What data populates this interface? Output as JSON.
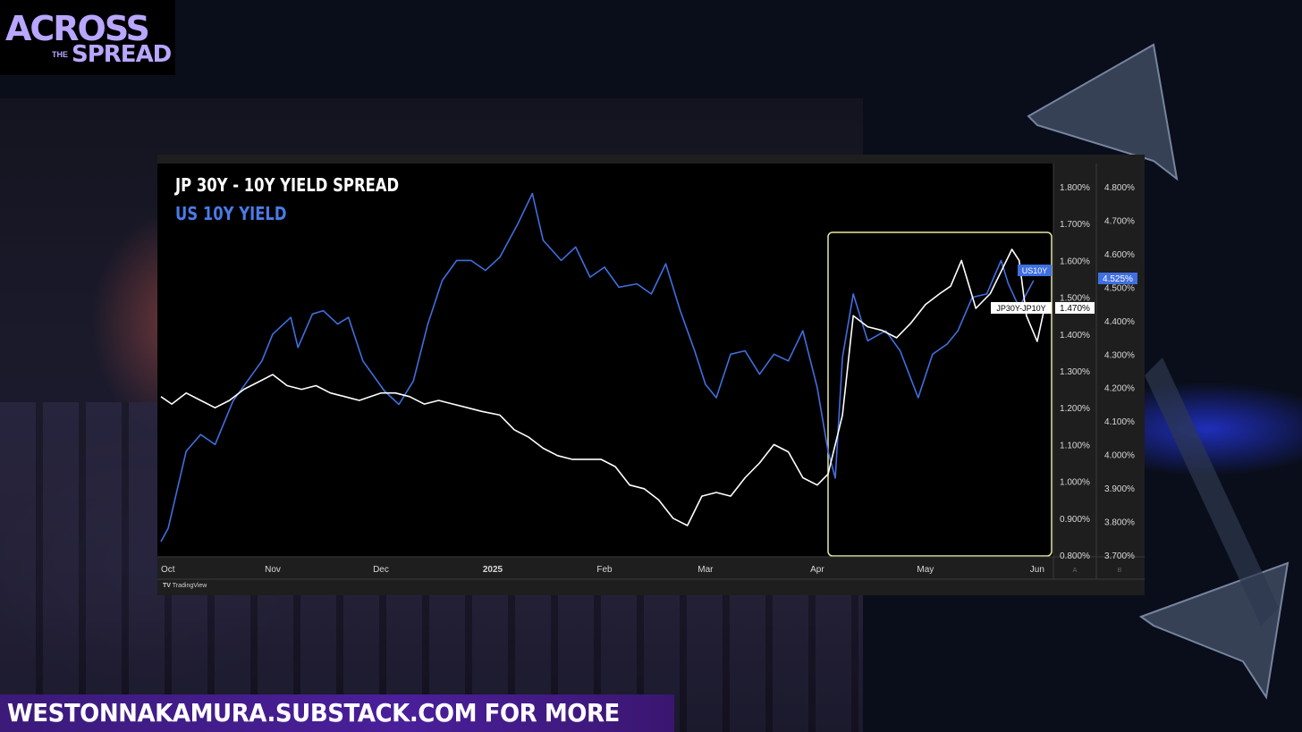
{
  "logo": {
    "line1": "ACROSS",
    "line2": "THE",
    "line3": "SPREAD"
  },
  "footer": {
    "text": "WESTONNAKAMURA.SUBSTACK.COM FOR MORE"
  },
  "tradingview": {
    "label": "TradingView"
  },
  "colors": {
    "us10y": "#3f6fe0",
    "jp_spread": "#ffffff",
    "highlight_box": "#e8e8a0",
    "background": "#000000"
  },
  "chart_data": {
    "type": "line",
    "title": "JP 30Y - 10Y YIELD SPREAD",
    "subtitle": "US 10Y YIELD",
    "x_ticks": [
      "Oct",
      "Nov",
      "Dec",
      "2025",
      "Feb",
      "Mar",
      "Apr",
      "May",
      "Jun"
    ],
    "x_range": [
      "2024-10-01",
      "2025-06-05"
    ],
    "axis_a": {
      "ticks": [
        "1.800%",
        "1.700%",
        "1.600%",
        "1.500%",
        "1.400%",
        "1.300%",
        "1.200%",
        "1.100%",
        "1.000%",
        "0.900%",
        "0.800%"
      ],
      "range": [
        0.8,
        1.8
      ],
      "footer": "A"
    },
    "axis_b": {
      "ticks": [
        "4.800%",
        "4.700%",
        "4.600%",
        "4.500%",
        "4.400%",
        "4.300%",
        "4.200%",
        "4.100%",
        "4.000%",
        "3.900%",
        "3.800%",
        "3.700%"
      ],
      "range": [
        3.7,
        4.8
      ],
      "footer": "B"
    },
    "series": [
      {
        "name": "US10Y",
        "axis": "B",
        "last_value": "4.525%",
        "points": [
          [
            "2024-10-01",
            3.74
          ],
          [
            "2024-10-03",
            3.78
          ],
          [
            "2024-10-08",
            4.01
          ],
          [
            "2024-10-12",
            4.06
          ],
          [
            "2024-10-16",
            4.03
          ],
          [
            "2024-10-21",
            4.16
          ],
          [
            "2024-10-25",
            4.22
          ],
          [
            "2024-10-29",
            4.28
          ],
          [
            "2024-11-01",
            4.36
          ],
          [
            "2024-11-06",
            4.41
          ],
          [
            "2024-11-08",
            4.32
          ],
          [
            "2024-11-12",
            4.42
          ],
          [
            "2024-11-15",
            4.43
          ],
          [
            "2024-11-19",
            4.39
          ],
          [
            "2024-11-22",
            4.41
          ],
          [
            "2024-11-26",
            4.28
          ],
          [
            "2024-12-02",
            4.19
          ],
          [
            "2024-12-06",
            4.15
          ],
          [
            "2024-12-10",
            4.22
          ],
          [
            "2024-12-14",
            4.39
          ],
          [
            "2024-12-18",
            4.52
          ],
          [
            "2024-12-22",
            4.58
          ],
          [
            "2024-12-26",
            4.58
          ],
          [
            "2024-12-30",
            4.55
          ],
          [
            "2025-01-03",
            4.59
          ],
          [
            "2025-01-08",
            4.69
          ],
          [
            "2025-01-12",
            4.78
          ],
          [
            "2025-01-15",
            4.64
          ],
          [
            "2025-01-20",
            4.58
          ],
          [
            "2025-01-24",
            4.62
          ],
          [
            "2025-01-28",
            4.53
          ],
          [
            "2025-02-01",
            4.56
          ],
          [
            "2025-02-05",
            4.5
          ],
          [
            "2025-02-10",
            4.51
          ],
          [
            "2025-02-14",
            4.48
          ],
          [
            "2025-02-18",
            4.57
          ],
          [
            "2025-02-22",
            4.43
          ],
          [
            "2025-02-26",
            4.31
          ],
          [
            "2025-03-01",
            4.21
          ],
          [
            "2025-03-04",
            4.17
          ],
          [
            "2025-03-08",
            4.3
          ],
          [
            "2025-03-12",
            4.31
          ],
          [
            "2025-03-16",
            4.24
          ],
          [
            "2025-03-20",
            4.3
          ],
          [
            "2025-03-24",
            4.28
          ],
          [
            "2025-03-28",
            4.37
          ],
          [
            "2025-04-01",
            4.2
          ],
          [
            "2025-04-04",
            4.01
          ],
          [
            "2025-04-06",
            3.93
          ],
          [
            "2025-04-08",
            4.29
          ],
          [
            "2025-04-11",
            4.48
          ],
          [
            "2025-04-15",
            4.34
          ],
          [
            "2025-04-20",
            4.37
          ],
          [
            "2025-04-24",
            4.31
          ],
          [
            "2025-04-29",
            4.17
          ],
          [
            "2025-05-03",
            4.3
          ],
          [
            "2025-05-07",
            4.33
          ],
          [
            "2025-05-10",
            4.37
          ],
          [
            "2025-05-14",
            4.47
          ],
          [
            "2025-05-18",
            4.48
          ],
          [
            "2025-05-22",
            4.58
          ],
          [
            "2025-05-24",
            4.51
          ],
          [
            "2025-05-27",
            4.44
          ],
          [
            "2025-05-31",
            4.52
          ]
        ]
      },
      {
        "name": "JP30Y-JP10Y",
        "axis": "A",
        "last_value": "1.470%",
        "points": [
          [
            "2024-10-01",
            1.23
          ],
          [
            "2024-10-04",
            1.21
          ],
          [
            "2024-10-08",
            1.24
          ],
          [
            "2024-10-12",
            1.22
          ],
          [
            "2024-10-16",
            1.2
          ],
          [
            "2024-10-20",
            1.22
          ],
          [
            "2024-10-24",
            1.25
          ],
          [
            "2024-10-28",
            1.27
          ],
          [
            "2024-11-01",
            1.29
          ],
          [
            "2024-11-05",
            1.26
          ],
          [
            "2024-11-09",
            1.25
          ],
          [
            "2024-11-13",
            1.26
          ],
          [
            "2024-11-17",
            1.24
          ],
          [
            "2024-11-21",
            1.23
          ],
          [
            "2024-11-25",
            1.22
          ],
          [
            "2024-12-01",
            1.24
          ],
          [
            "2024-12-05",
            1.24
          ],
          [
            "2024-12-09",
            1.23
          ],
          [
            "2024-12-13",
            1.21
          ],
          [
            "2024-12-17",
            1.22
          ],
          [
            "2024-12-21",
            1.21
          ],
          [
            "2024-12-25",
            1.2
          ],
          [
            "2024-12-29",
            1.19
          ],
          [
            "2025-01-03",
            1.18
          ],
          [
            "2025-01-07",
            1.14
          ],
          [
            "2025-01-11",
            1.12
          ],
          [
            "2025-01-15",
            1.09
          ],
          [
            "2025-01-19",
            1.07
          ],
          [
            "2025-01-23",
            1.06
          ],
          [
            "2025-01-27",
            1.06
          ],
          [
            "2025-01-31",
            1.06
          ],
          [
            "2025-02-04",
            1.04
          ],
          [
            "2025-02-08",
            0.99
          ],
          [
            "2025-02-12",
            0.98
          ],
          [
            "2025-02-16",
            0.95
          ],
          [
            "2025-02-20",
            0.9
          ],
          [
            "2025-02-24",
            0.88
          ],
          [
            "2025-02-28",
            0.96
          ],
          [
            "2025-03-04",
            0.97
          ],
          [
            "2025-03-08",
            0.96
          ],
          [
            "2025-03-12",
            1.01
          ],
          [
            "2025-03-16",
            1.05
          ],
          [
            "2025-03-20",
            1.1
          ],
          [
            "2025-03-24",
            1.08
          ],
          [
            "2025-03-28",
            1.01
          ],
          [
            "2025-04-01",
            0.99
          ],
          [
            "2025-04-04",
            1.02
          ],
          [
            "2025-04-08",
            1.18
          ],
          [
            "2025-04-11",
            1.45
          ],
          [
            "2025-04-15",
            1.42
          ],
          [
            "2025-04-19",
            1.41
          ],
          [
            "2025-04-23",
            1.39
          ],
          [
            "2025-04-27",
            1.43
          ],
          [
            "2025-05-01",
            1.48
          ],
          [
            "2025-05-05",
            1.51
          ],
          [
            "2025-05-08",
            1.53
          ],
          [
            "2025-05-11",
            1.6
          ],
          [
            "2025-05-15",
            1.47
          ],
          [
            "2025-05-19",
            1.51
          ],
          [
            "2025-05-22",
            1.57
          ],
          [
            "2025-05-25",
            1.63
          ],
          [
            "2025-05-27",
            1.6
          ],
          [
            "2025-05-29",
            1.45
          ],
          [
            "2025-06-01",
            1.38
          ],
          [
            "2025-06-03",
            1.47
          ]
        ]
      }
    ],
    "highlight_range": [
      "2025-04-04",
      "2025-06-05"
    ]
  }
}
